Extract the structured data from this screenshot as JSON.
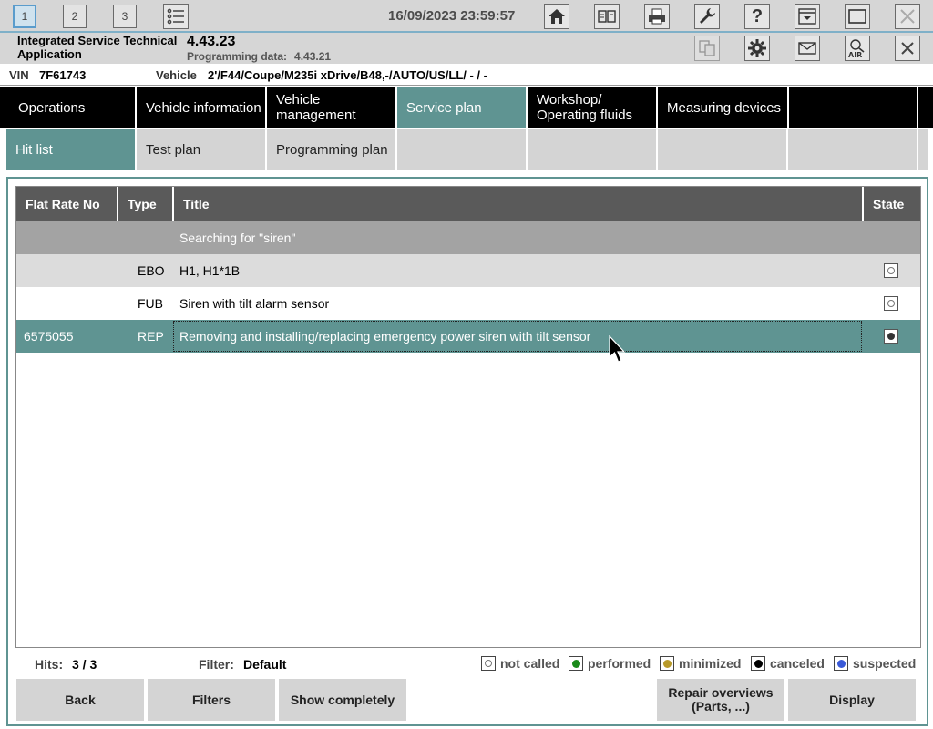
{
  "toolbar": {
    "sessions": [
      "1",
      "2",
      "3"
    ],
    "datetime": "16/09/2023 23:59:57"
  },
  "app": {
    "name": "Integrated Service Technical Application",
    "version": "4.43.23",
    "programming_label": "Programming data:",
    "programming_value": "4.43.21"
  },
  "vehicle": {
    "vin_label": "VIN",
    "vin": "7F61743",
    "vehicle_label": "Vehicle",
    "vehicle": "2'/F44/Coupe/M235i xDrive/B48,-/AUTO/US/LL/ - / -"
  },
  "main_nav": [
    {
      "label": "Operations"
    },
    {
      "label": "Vehicle information"
    },
    {
      "label": "Vehicle management"
    },
    {
      "label": "Service plan"
    },
    {
      "label": "Workshop/ Operating fluids"
    },
    {
      "label": "Measuring devices"
    }
  ],
  "sub_nav": [
    {
      "label": "Hit list"
    },
    {
      "label": "Test plan"
    },
    {
      "label": "Programming plan"
    }
  ],
  "table": {
    "columns": [
      "Flat Rate No",
      "Type",
      "Title",
      "State"
    ],
    "search_text": "Searching for \"siren\"",
    "rows": [
      {
        "flat_rate": "",
        "type": "EBO",
        "title": "H1, H1*1B"
      },
      {
        "flat_rate": "",
        "type": "FUB",
        "title": "Siren with tilt alarm sensor"
      },
      {
        "flat_rate": "6575055",
        "type": "REP",
        "title": "Removing and installing/replacing emergency power siren with tilt sensor"
      }
    ]
  },
  "footer": {
    "hits_label": "Hits:",
    "hits_value": "3 / 3",
    "filter_label": "Filter:",
    "filter_value": "Default",
    "legend": [
      {
        "label": "not called",
        "color": "#ffffff"
      },
      {
        "label": "performed",
        "color": "#1a8a1a"
      },
      {
        "label": "minimized",
        "color": "#b89a2a"
      },
      {
        "label": "canceled",
        "color": "#000000"
      },
      {
        "label": "suspected",
        "color": "#3a5ad8"
      }
    ]
  },
  "buttons": {
    "back": "Back",
    "filters": "Filters",
    "show_completely": "Show completely",
    "repair_overviews": "Repair overviews (Parts, ...)",
    "display": "Display"
  },
  "colors": {
    "accent": "#5f9492",
    "header": "#5a5a5a",
    "nav": "#000000"
  }
}
